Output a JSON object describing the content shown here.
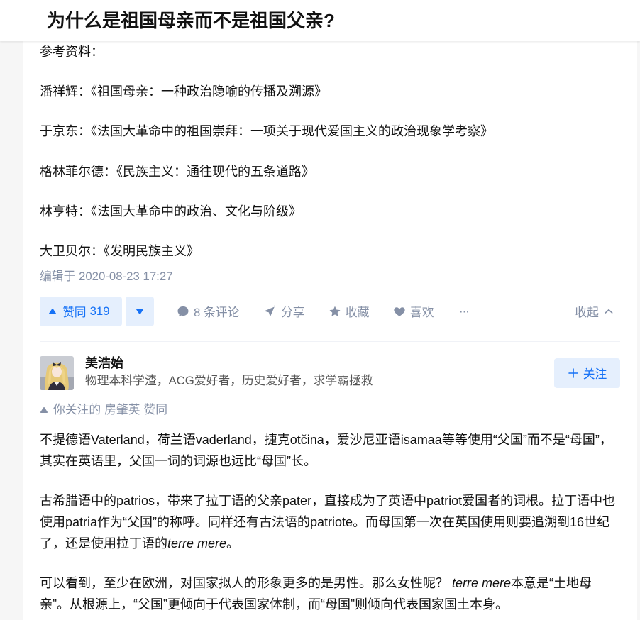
{
  "header": {
    "title": "为什么是祖国母亲而不是祖国父亲?"
  },
  "answer_1": {
    "references_heading": "参考资料：",
    "references": [
      "潘祥辉：《祖国母亲：一种政治隐喻的传播及溯源》",
      "于京东：《法国大革命中的祖国崇拜：一项关于现代爱国主义的政治现象学考察》",
      "格林菲尔德：《民族主义：通往现代的五条道路》",
      "林亨特：《法国大革命中的政治、文化与阶级》",
      "大卫贝尔：《发明民族主义》"
    ],
    "edited_time": "编辑于 2020-08-23 17:27",
    "actions": {
      "vote_up_label": "赞同",
      "vote_up_count": "319",
      "comments_label": "8 条评论",
      "share_label": "分享",
      "collect_label": "收藏",
      "like_label": "喜欢",
      "more_label": "···",
      "collapse_label": "收起"
    }
  },
  "answer_2": {
    "author": {
      "name": "美浩始",
      "bio": "物理本科学渣，ACG爱好者，历史爱好者，求学霸拯救",
      "follow_label": "关注"
    },
    "upvoted_by": {
      "prefix": "你关注的",
      "user": "房肇英",
      "suffix": "赞同"
    },
    "paragraphs": [
      [
        "不提德语Vaterland，荷兰语vaderland，捷克otčina，爱沙尼亚语isamaa等等使用“父国”而不是“母国”，其实在英语里，父国一词的词源也远比“母国”长。"
      ],
      [
        "古希腊语中的patrios，带来了拉丁语的父亲pater，直接成为了英语中patriot爱国者的词根。拉丁语中也使用patria作为“父国”的称呼。同样还有古法语的patriote。而母国第一次在英国使用则要追溯到16世纪了，还是使用拉丁语的",
        "terre mere",
        "。"
      ],
      [
        "可以看到，至少在欧洲，对国家拟人的形象更多的是男性。那么女性呢？ ",
        "terre mere",
        "本意是“土地母亲”。从根源上，“父国”更倾向于代表国家体制，而“母国”则倾向代表国家国土本身。"
      ]
    ]
  },
  "icons": {
    "vote_up": "triangle-up-icon",
    "vote_down": "triangle-down-icon",
    "comment": "comment-bubble-icon",
    "share": "paper-plane-icon",
    "collect": "star-icon",
    "like": "heart-icon",
    "collapse": "chevron-up-icon",
    "follow": "plus-icon",
    "upvoted_by": "triangle-up-icon"
  },
  "colors": {
    "text": "#121212",
    "muted": "#8590a6",
    "brand_blue": "#1772f6",
    "brand_blue_bg": "#e5effd",
    "page_bg": "#f6f6f6",
    "card_bg": "#ffffff"
  }
}
